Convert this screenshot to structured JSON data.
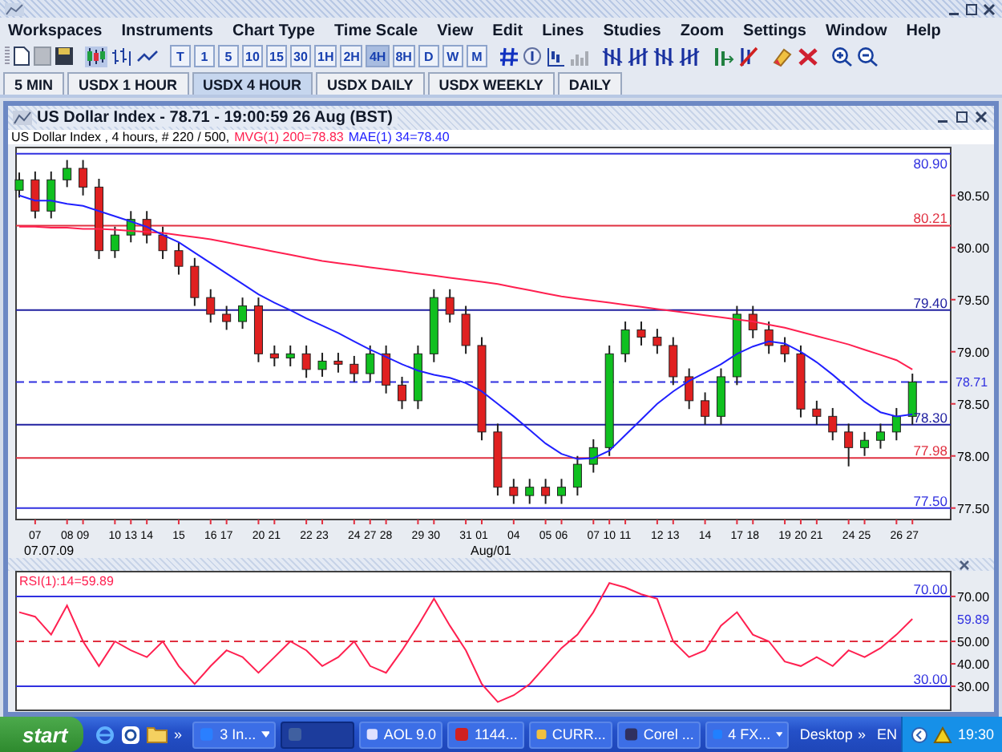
{
  "menu": [
    "Workspaces",
    "Instruments",
    "Chart Type",
    "Time Scale",
    "View",
    "Edit",
    "Lines",
    "Studies",
    "Zoom",
    "Settings",
    "Window",
    "Help"
  ],
  "toolbar": {
    "timeframes": [
      {
        "label": "T",
        "selected": false
      },
      {
        "label": "1",
        "selected": false
      },
      {
        "label": "5",
        "selected": false
      },
      {
        "label": "10",
        "selected": false
      },
      {
        "label": "15",
        "selected": false
      },
      {
        "label": "30",
        "selected": false
      },
      {
        "label": "1H",
        "selected": false
      },
      {
        "label": "2H",
        "selected": false
      },
      {
        "label": "4H",
        "selected": true
      },
      {
        "label": "8H",
        "selected": false
      },
      {
        "label": "D",
        "selected": false
      },
      {
        "label": "W",
        "selected": false
      },
      {
        "label": "M",
        "selected": false
      }
    ]
  },
  "tabs": [
    {
      "label": "5 MIN",
      "selected": false
    },
    {
      "label": "USDX 1 HOUR",
      "selected": false
    },
    {
      "label": "USDX 4 HOUR",
      "selected": true
    },
    {
      "label": "USDX DAILY",
      "selected": false
    },
    {
      "label": "USDX WEEKLY",
      "selected": false
    },
    {
      "label": "DAILY",
      "selected": false
    }
  ],
  "chart_window": {
    "title": "US Dollar Index - 78.71 - 19:00:59  26 Aug (BST)",
    "price_chart": {
      "chart_data": {
        "type": "candlestick",
        "title": "US Dollar Index , 4 hours, # 220 / 500,",
        "categories": [
          null,
          "07",
          null,
          "08",
          "09",
          null,
          "10",
          "13",
          "14",
          null,
          "15",
          null,
          "16",
          "17",
          null,
          "20",
          "21",
          null,
          "22",
          "23",
          null,
          "24",
          "27",
          "28",
          null,
          "29",
          "30",
          null,
          "31",
          "01",
          null,
          "04",
          null,
          "05",
          "06",
          null,
          "07",
          "10",
          "11",
          null,
          "12",
          "13",
          null,
          "14",
          null,
          "17",
          "18",
          null,
          "19",
          "20",
          "21",
          null,
          "24",
          "25",
          null,
          "26",
          "27"
        ],
        "ylim": [
          77.39,
          80.96
        ],
        "yticks": [
          {
            "value": 80.5,
            "label": "80.50"
          },
          {
            "value": 80,
            "label": "80.00"
          },
          {
            "value": 79.5,
            "label": "79.50"
          },
          {
            "value": 79,
            "label": "79.00"
          },
          {
            "value": 78.5,
            "label": "78.50"
          },
          {
            "value": 78,
            "label": "78.00"
          },
          {
            "value": 77.5,
            "label": "77.50"
          }
        ],
        "ohlc": [
          [
            80.55,
            80.72,
            80.48,
            80.65
          ],
          [
            80.65,
            80.73,
            80.28,
            80.35
          ],
          [
            80.35,
            80.73,
            80.28,
            80.65
          ],
          [
            80.65,
            80.84,
            80.58,
            80.76
          ],
          [
            80.76,
            80.84,
            80.5,
            80.58
          ],
          [
            80.58,
            80.66,
            79.89,
            79.97
          ],
          [
            79.97,
            80.2,
            79.9,
            80.12
          ],
          [
            80.12,
            80.35,
            80.05,
            80.27
          ],
          [
            80.27,
            80.35,
            80.04,
            80.12
          ],
          [
            80.12,
            80.2,
            79.89,
            79.97
          ],
          [
            79.97,
            80.05,
            79.74,
            79.82
          ],
          [
            79.82,
            79.9,
            79.44,
            79.52
          ],
          [
            79.52,
            79.6,
            79.28,
            79.36
          ],
          [
            79.36,
            79.44,
            79.21,
            79.29
          ],
          [
            79.29,
            79.52,
            79.22,
            79.44
          ],
          [
            79.44,
            79.52,
            78.9,
            78.98
          ],
          [
            78.98,
            79.06,
            78.86,
            78.94
          ],
          [
            78.94,
            79.06,
            78.86,
            78.98
          ],
          [
            78.98,
            79.06,
            78.75,
            78.83
          ],
          [
            78.83,
            78.99,
            78.76,
            78.91
          ],
          [
            78.91,
            78.99,
            78.8,
            78.88
          ],
          [
            78.88,
            78.96,
            78.71,
            78.79
          ],
          [
            78.79,
            79.06,
            78.71,
            78.98
          ],
          [
            78.98,
            79.06,
            78.6,
            78.68
          ],
          [
            78.68,
            78.76,
            78.45,
            78.53
          ],
          [
            78.53,
            79.06,
            78.45,
            78.98
          ],
          [
            78.98,
            79.6,
            78.9,
            79.52
          ],
          [
            79.52,
            79.6,
            79.28,
            79.36
          ],
          [
            79.36,
            79.44,
            78.98,
            79.06
          ],
          [
            79.06,
            79.14,
            78.15,
            78.23
          ],
          [
            78.23,
            78.31,
            77.62,
            77.7
          ],
          [
            77.7,
            77.78,
            77.54,
            77.62
          ],
          [
            77.62,
            77.78,
            77.54,
            77.7
          ],
          [
            77.7,
            77.78,
            77.54,
            77.62
          ],
          [
            77.62,
            77.78,
            77.54,
            77.7
          ],
          [
            77.7,
            78.0,
            77.62,
            77.92
          ],
          [
            77.92,
            78.16,
            77.84,
            78.08
          ],
          [
            78.08,
            79.06,
            78.0,
            78.98
          ],
          [
            78.98,
            79.29,
            78.9,
            79.21
          ],
          [
            79.21,
            79.29,
            79.06,
            79.14
          ],
          [
            79.14,
            79.22,
            78.98,
            79.06
          ],
          [
            79.06,
            79.14,
            78.68,
            78.76
          ],
          [
            78.76,
            78.84,
            78.45,
            78.53
          ],
          [
            78.53,
            78.61,
            78.3,
            78.38
          ],
          [
            78.38,
            78.84,
            78.3,
            78.76
          ],
          [
            78.76,
            79.44,
            78.68,
            79.36
          ],
          [
            79.36,
            79.44,
            79.13,
            79.21
          ],
          [
            79.21,
            79.29,
            78.98,
            79.06
          ],
          [
            79.06,
            79.14,
            78.9,
            78.98
          ],
          [
            78.98,
            79.06,
            78.37,
            78.45
          ],
          [
            78.45,
            78.53,
            78.3,
            78.38
          ],
          [
            78.38,
            78.46,
            78.15,
            78.23
          ],
          [
            78.23,
            78.31,
            77.9,
            78.08
          ],
          [
            78.08,
            78.23,
            78.0,
            78.15
          ],
          [
            78.15,
            78.31,
            78.07,
            78.23
          ],
          [
            78.23,
            78.46,
            78.15,
            78.38
          ],
          [
            78.38,
            78.79,
            78.3,
            78.71
          ]
        ],
        "series": [
          {
            "name": "MVG(1) 200=78.83",
            "type": "line",
            "color": "#ff2050",
            "values": [
              80.2,
              80.2,
              80.19,
              80.19,
              80.18,
              80.18,
              80.17,
              80.16,
              80.15,
              80.14,
              80.12,
              80.1,
              80.08,
              80.05,
              80.02,
              79.99,
              79.96,
              79.93,
              79.9,
              79.87,
              79.85,
              79.83,
              79.81,
              79.79,
              79.77,
              79.75,
              79.73,
              79.71,
              79.69,
              79.67,
              79.65,
              79.62,
              79.59,
              79.56,
              79.53,
              79.51,
              79.49,
              79.47,
              79.45,
              79.43,
              79.41,
              79.39,
              79.37,
              79.35,
              79.33,
              79.31,
              79.29,
              79.26,
              79.23,
              79.19,
              79.15,
              79.11,
              79.07,
              79.02,
              78.97,
              78.92,
              78.83
            ]
          },
          {
            "name": "MAE(1) 34=78.40",
            "type": "line",
            "color": "#2020ff",
            "values": [
              80.5,
              80.45,
              80.45,
              80.42,
              80.4,
              80.35,
              80.3,
              80.25,
              80.2,
              80.12,
              80.05,
              79.95,
              79.85,
              79.75,
              79.65,
              79.55,
              79.47,
              79.4,
              79.32,
              79.25,
              79.18,
              79.1,
              79.02,
              78.95,
              78.88,
              78.82,
              78.78,
              78.75,
              78.7,
              78.62,
              78.5,
              78.38,
              78.25,
              78.12,
              78.02,
              77.97,
              77.98,
              78.05,
              78.2,
              78.35,
              78.5,
              78.62,
              78.72,
              78.8,
              78.88,
              78.98,
              79.05,
              79.1,
              79.08,
              79.0,
              78.9,
              78.78,
              78.65,
              78.52,
              78.42,
              78.38,
              78.4
            ]
          }
        ],
        "ref_lines": [
          {
            "axis": "y",
            "value": 80.9,
            "label": "80.90",
            "color": "#3030e0"
          },
          {
            "axis": "y",
            "value": 80.21,
            "label": "80.21",
            "color": "#e03040"
          },
          {
            "axis": "y",
            "value": 79.4,
            "label": "79.40",
            "color": "#2020a0"
          },
          {
            "axis": "y",
            "value": 78.71,
            "label": "78.71",
            "color": "#3030e0"
          },
          {
            "axis": "y",
            "value": 78.3,
            "label": "78.30",
            "color": "#2020a0"
          },
          {
            "axis": "y",
            "value": 77.98,
            "label": "77.98",
            "color": "#e03040"
          },
          {
            "axis": "y",
            "value": 77.5,
            "label": "77.50",
            "color": "#3030e0"
          }
        ]
      },
      "period_labels": [
        "07.07.09",
        "Aug/01"
      ]
    },
    "rsi_panel": {
      "chart_data": {
        "type": "line",
        "ylim": [
          19.3,
          81.4
        ],
        "yticks": [
          {
            "value": 70,
            "label": "70.00"
          },
          {
            "value": 50,
            "label": "50.00"
          },
          {
            "value": 40,
            "label": "40.00"
          },
          {
            "value": 30,
            "label": "30.00"
          }
        ],
        "series": [
          {
            "name": "RSI(1):14=59.89",
            "color": "#ff2050",
            "values": [
              63,
              61,
              53,
              66,
              50,
              39,
              50,
              46,
              43,
              50,
              39,
              31,
              39,
              46,
              43,
              36,
              43,
              50,
              46,
              39,
              43,
              50,
              39,
              36,
              46,
              57,
              69,
              57,
              46,
              31,
              23,
              26,
              31,
              39,
              47,
              53,
              63,
              76,
              74,
              71,
              69,
              50,
              43,
              46,
              57,
              63,
              53,
              50,
              41,
              39,
              43,
              39,
              46,
              43,
              47,
              53,
              60
            ]
          }
        ],
        "ref_lines": [
          {
            "axis": "y",
            "value": 70,
            "label": "70.00",
            "color": "#3030e0"
          },
          {
            "axis": "y",
            "value": 50,
            "color": "#e03040"
          },
          {
            "axis": "y",
            "value": 30,
            "label": "30.00",
            "color": "#3030e0"
          }
        ],
        "annotations": [
          "59.89"
        ]
      }
    }
  },
  "taskbar": {
    "start": "start",
    "chevron": "»",
    "items": [
      {
        "label": "3 In...",
        "kind": "browser",
        "selected": false,
        "grouped": true
      },
      {
        "kind": "chart",
        "selected": true,
        "grouped": false
      },
      {
        "label": "AOL 9.0",
        "kind": "aol",
        "selected": false,
        "grouped": false
      },
      {
        "label": "1144...",
        "kind": "pdf",
        "selected": false,
        "grouped": false
      },
      {
        "label": "CURR...",
        "kind": "folder",
        "selected": false,
        "grouped": false
      },
      {
        "label": "Corel ...",
        "kind": "corel",
        "selected": false,
        "grouped": false
      },
      {
        "label": "4 FX...",
        "kind": "fx",
        "selected": false,
        "grouped": true
      }
    ],
    "desktop": "Desktop",
    "desktop_chevron": "»",
    "language": "EN",
    "clock": "19:30"
  }
}
